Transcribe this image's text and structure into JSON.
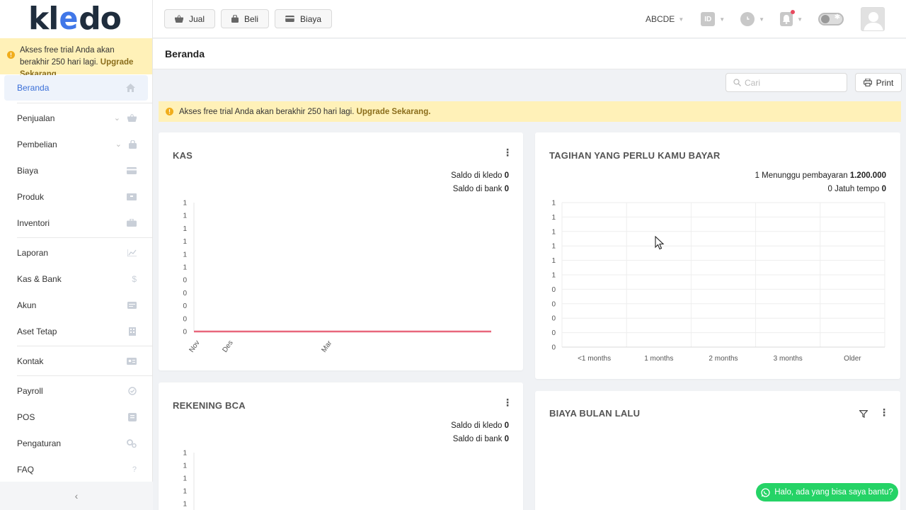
{
  "brand": {
    "logo_prefix": "kl",
    "logo_e": "e",
    "logo_suffix": "do"
  },
  "trial": {
    "message": "Akses free trial Anda akan berakhir 250 hari lagi.",
    "upgrade": "Upgrade Sekarang."
  },
  "sidebar": {
    "items": [
      {
        "label": "Beranda",
        "icon": "home-icon"
      },
      {
        "label": "Penjualan",
        "icon": "basket-icon"
      },
      {
        "label": "Pembelian",
        "icon": "bag-icon"
      },
      {
        "label": "Biaya",
        "icon": "card-icon"
      },
      {
        "label": "Produk",
        "icon": "box-icon"
      },
      {
        "label": "Inventori",
        "icon": "briefcase-icon"
      },
      {
        "label": "Laporan",
        "icon": "chart-icon"
      },
      {
        "label": "Kas & Bank",
        "icon": "dollar-icon"
      },
      {
        "label": "Akun",
        "icon": "ledger-icon"
      },
      {
        "label": "Aset Tetap",
        "icon": "building-icon"
      },
      {
        "label": "Kontak",
        "icon": "contact-icon"
      },
      {
        "label": "Payroll",
        "icon": "payroll-icon"
      },
      {
        "label": "POS",
        "icon": "pos-icon"
      },
      {
        "label": "Pengaturan",
        "icon": "gears-icon"
      },
      {
        "label": "FAQ",
        "icon": "question-icon"
      }
    ],
    "collapse": "‹"
  },
  "topbar": {
    "jual": "Jual",
    "beli": "Beli",
    "biaya": "Biaya",
    "company": "ABCDE",
    "lang": "ID"
  },
  "page": {
    "title": "Beranda"
  },
  "search": {
    "placeholder": "Cari"
  },
  "print": "Print",
  "kas": {
    "title": "KAS",
    "saldo_kledo_label": "Saldo di kledo",
    "saldo_kledo_value": "0",
    "saldo_bank_label": "Saldo di bank",
    "saldo_bank_value": "0"
  },
  "tagihan": {
    "title": "TAGIHAN YANG PERLU KAMU BAYAR",
    "waiting_label": "1 Menunggu pembayaran",
    "waiting_value": "1.200.000",
    "due_label": "0 Jatuh tempo",
    "due_value": "0"
  },
  "rekening": {
    "title": "REKENING BCA",
    "saldo_kledo_label": "Saldo di kledo",
    "saldo_kledo_value": "0",
    "saldo_bank_label": "Saldo di bank",
    "saldo_bank_value": "0"
  },
  "biaya_bulan_lalu": {
    "title": "BIAYA BULAN LALU"
  },
  "chat": {
    "label": "Halo, ada yang bisa saya bantu?"
  },
  "colors": {
    "accent": "#3a6fd8",
    "trial_bg": "#fff1b8",
    "line": "#e8677c",
    "chat": "#25d366"
  },
  "chart_data": [
    {
      "type": "line",
      "title": "KAS",
      "x": [
        "Nov",
        "Des",
        "Mar"
      ],
      "y_ticks": [
        "1",
        "1",
        "1",
        "1",
        "1",
        "1",
        "0",
        "0",
        "0",
        "0",
        "0"
      ],
      "series": [
        {
          "values": [
            0,
            0,
            0
          ]
        }
      ],
      "ylim": [
        0,
        1
      ]
    },
    {
      "type": "bar",
      "title": "TAGIHAN YANG PERLU KAMU BAYAR",
      "categories": [
        "<1 months",
        "1 months",
        "2 months",
        "3 months",
        "Older"
      ],
      "y_ticks": [
        "1",
        "1",
        "1",
        "1",
        "1",
        "1",
        "0",
        "0",
        "0",
        "0",
        "0"
      ],
      "values": [
        0,
        0,
        0,
        0,
        0
      ],
      "ylim": [
        0,
        1
      ]
    },
    {
      "type": "line",
      "title": "REKENING BCA",
      "y_ticks": [
        "1",
        "1",
        "1",
        "1",
        "1"
      ],
      "series": [],
      "ylim": [
        0,
        1
      ]
    }
  ]
}
